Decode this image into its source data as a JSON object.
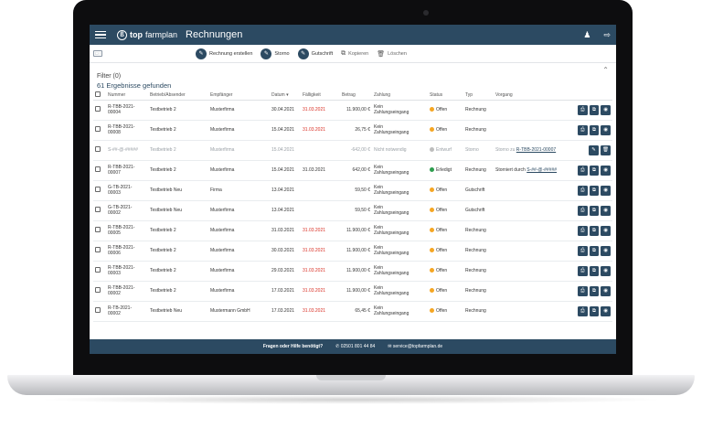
{
  "app": {
    "logo_prefix": "top",
    "logo_suffix": "farmplan",
    "title": "Rechnungen",
    "user_icon": "user-icon",
    "logout_icon": "logout-icon"
  },
  "toolbar": {
    "select_label": "☐ ⁝",
    "create_label": "Rechnung erstellen",
    "storno_label": "Storno",
    "gutschrift_label": "Gutschrift",
    "copy_label": "Kopieren",
    "delete_label": "Löschen"
  },
  "filter": {
    "label": "Filter (0)",
    "results": "61 Ergebnisse gefunden"
  },
  "columns": {
    "nummer": "Nummer",
    "betrieb": "Betrieb/Absender",
    "empfaenger": "Empfänger",
    "datum": "Datum ▾",
    "faelligkeit": "Fälligkeit",
    "betrag": "Betrag",
    "zahlung": "Zahlung",
    "status": "Status",
    "typ": "Typ",
    "vorgang": "Vorgang"
  },
  "colors": {
    "primary": "#2c4a62",
    "offen": "#f5a623",
    "entwurf": "#bdbdbd",
    "erledigt": "#2e9e4e",
    "overdue": "#d93025"
  },
  "rows": [
    {
      "nr1": "R-TBB-2021-",
      "nr2": "00004",
      "betrieb": "Testbetrieb 2",
      "empf": "Musterfirma",
      "datum": "30.04.2021",
      "faellig": "31.03.2021",
      "betrag": "11.900,00 €",
      "zahl1": "Kein",
      "zahl2": "Zahlungseingang",
      "status": "Offen",
      "typ": "Rechnung",
      "vorgang": "",
      "vlink": ""
    },
    {
      "nr1": "R-TBB-2021-",
      "nr2": "00008",
      "betrieb": "Testbetrieb 2",
      "empf": "Musterfirma",
      "datum": "15.04.2021",
      "faellig": "31.03.2021",
      "betrag": "26,75 €",
      "zahl1": "Kein",
      "zahl2": "Zahlungseingang",
      "status": "Offen",
      "typ": "Rechnung",
      "vorgang": "",
      "vlink": ""
    },
    {
      "nr1": "S-##-@-#####",
      "nr2": "",
      "betrieb": "Testbetrieb 2",
      "empf": "Musterfirma",
      "datum": "15.04.2021",
      "faellig": "",
      "betrag": "-642,00 €",
      "zahl1": "Nicht notwendig",
      "zahl2": "",
      "status": "Entwurf",
      "typ": "Storno",
      "vorgang": "Storno zu ",
      "vlink": "R-TBB-2021-00007"
    },
    {
      "nr1": "R-TBB-2021-",
      "nr2": "00007",
      "betrieb": "Testbetrieb 2",
      "empf": "Musterfirma",
      "datum": "15.04.2021",
      "faellig": "31.03.2021",
      "betrag": "642,00 €",
      "zahl1": "Kein",
      "zahl2": "Zahlungseingang",
      "status": "Erledigt",
      "typ": "Rechnung",
      "vorgang": "Storniert durch ",
      "vlink": "S-##-@-#####"
    },
    {
      "nr1": "G-TB-2021-",
      "nr2": "00003",
      "betrieb": "Testbetrieb Neu",
      "empf": "Firma",
      "datum": "13.04.2021",
      "faellig": "",
      "betrag": "59,50 €",
      "zahl1": "Kein",
      "zahl2": "Zahlungseingang",
      "status": "Offen",
      "typ": "Gutschrift",
      "vorgang": "",
      "vlink": ""
    },
    {
      "nr1": "G-TB-2021-",
      "nr2": "00002",
      "betrieb": "Testbetrieb Neu",
      "empf": "Musterfirma",
      "datum": "13.04.2021",
      "faellig": "",
      "betrag": "59,50 €",
      "zahl1": "Kein",
      "zahl2": "Zahlungseingang",
      "status": "Offen",
      "typ": "Gutschrift",
      "vorgang": "",
      "vlink": ""
    },
    {
      "nr1": "R-TBB-2021-",
      "nr2": "00005",
      "betrieb": "Testbetrieb 2",
      "empf": "Musterfirma",
      "datum": "31.03.2021",
      "faellig": "31.03.2021",
      "betrag": "11.900,00 €",
      "zahl1": "Kein",
      "zahl2": "Zahlungseingang",
      "status": "Offen",
      "typ": "Rechnung",
      "vorgang": "",
      "vlink": ""
    },
    {
      "nr1": "R-TBB-2021-",
      "nr2": "00006",
      "betrieb": "Testbetrieb 2",
      "empf": "Musterfirma",
      "datum": "30.03.2021",
      "faellig": "31.03.2021",
      "betrag": "11.900,00 €",
      "zahl1": "Kein",
      "zahl2": "Zahlungseingang",
      "status": "Offen",
      "typ": "Rechnung",
      "vorgang": "",
      "vlink": ""
    },
    {
      "nr1": "R-TBB-2021-",
      "nr2": "00003",
      "betrieb": "Testbetrieb 2",
      "empf": "Musterfirma",
      "datum": "29.03.2021",
      "faellig": "31.03.2021",
      "betrag": "11.900,00 €",
      "zahl1": "Kein",
      "zahl2": "Zahlungseingang",
      "status": "Offen",
      "typ": "Rechnung",
      "vorgang": "",
      "vlink": ""
    },
    {
      "nr1": "R-TBB-2021-",
      "nr2": "00002",
      "betrieb": "Testbetrieb 2",
      "empf": "Musterfirma",
      "datum": "17.03.2021",
      "faellig": "31.03.2021",
      "betrag": "11.900,00 €",
      "zahl1": "Kein",
      "zahl2": "Zahlungseingang",
      "status": "Offen",
      "typ": "Rechnung",
      "vorgang": "",
      "vlink": ""
    },
    {
      "nr1": "R-TB-2021-",
      "nr2": "00002",
      "betrieb": "Testbetrieb Neu",
      "empf": "Mustermann GmbH",
      "datum": "17.03.2021",
      "faellig": "31.03.2021",
      "betrag": "65,45 €",
      "zahl1": "Kein",
      "zahl2": "Zahlungseingang",
      "status": "Offen",
      "typ": "Rechnung",
      "vorgang": "",
      "vlink": ""
    }
  ],
  "footer": {
    "help": "Fragen oder Hilfe benötigt?",
    "phone": "02501 801 44 84",
    "email": "service@topfarmplan.de"
  }
}
